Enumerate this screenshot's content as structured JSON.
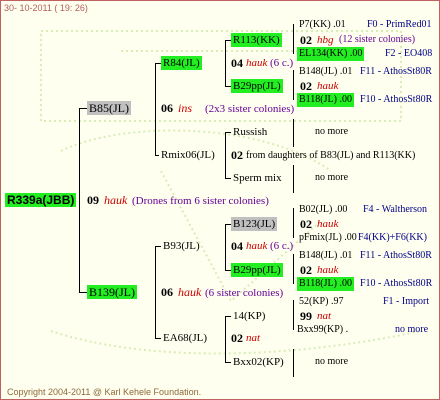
{
  "header": {
    "date": "30- 10-2011 ( 19: 26)"
  },
  "footer": {
    "copyright": "Copyright 2004-2011 @ Karl Kehele Foundation."
  },
  "root": {
    "id": "R339a(JBB)",
    "gen": "09",
    "breeder": "hauk",
    "note": "(Drones from 6 sister colonies)"
  },
  "upper": {
    "id": "B85(JL)",
    "gen": "06",
    "breeder": "ins",
    "note": "(2x3 sister colonies)",
    "a": {
      "id": "R84(JL)",
      "gen": "04",
      "breeder": "hauk",
      "note": "(6 c.)"
    },
    "a1": {
      "id": "R113(KK)",
      "gen": "02",
      "breeder": "hbg",
      "note": "(12 sister colonies)"
    },
    "a2": {
      "id": "B29pp(JL)",
      "gen": "02",
      "breeder": "hauk"
    },
    "b": {
      "id": "Rmix06(JL)",
      "gen": "02",
      "note": "from daughters of B83(JL) and R113(KK)"
    },
    "b1": {
      "id": "Russish"
    },
    "b2": {
      "id": "Sperm mix"
    }
  },
  "lower": {
    "id": "B139(JL)",
    "gen": "06",
    "breeder": "hauk",
    "note": "(6 sister colonies)",
    "a": {
      "id": "B93(JL)",
      "gen": "04",
      "breeder": "hauk",
      "note": "(6 c.)"
    },
    "a1": {
      "id": "B123(JL)",
      "gen": "02",
      "breeder": "hauk"
    },
    "a2": {
      "id": "B29pp(JL)",
      "gen": "02",
      "breeder": "hauk"
    },
    "b": {
      "id": "EA68(JL)",
      "gen": "02",
      "breeder": "nat"
    },
    "b1": {
      "id": "14(KP)",
      "gen": "99",
      "breeder": "nat"
    },
    "b2": {
      "id": "Bxx02(KP)"
    }
  },
  "right": {
    "r1": {
      "left": "P7(KK) .01",
      "right": "F0 - PrimRed01"
    },
    "r2": {
      "left": "EL134(KK) .00",
      "right": "F2 - EO408"
    },
    "r3": {
      "left": "B148(JL) .01",
      "right": "F11 - AthosSt80R"
    },
    "r4": {
      "left": "B118(JL) .00",
      "right": "F10 - AthosSt80R"
    },
    "r5": {
      "text": "no more"
    },
    "r6": {
      "text": "no more"
    },
    "r7": {
      "left": "B02(JL) .00",
      "right": "F4 - Waltherson"
    },
    "r8": {
      "left": "pFmix(JL) .00",
      "right": "F4(KK)+F6(KK)"
    },
    "r9": {
      "left": "B148(JL) .01",
      "right": "F11 - AthosSt80R"
    },
    "r10": {
      "left": "B118(JL) .00",
      "right": "F10 - AthosSt80R"
    },
    "r11": {
      "left": "52(KP) .97",
      "right": "F1 - Import"
    },
    "r12": {
      "left": "Bxx99(KP) .",
      "right": "no more"
    },
    "r13": {
      "text": "no more"
    }
  },
  "colors": {
    "green": "#22ee22",
    "gray": "#c0c0c0",
    "breeder": "#cc0000",
    "note": "#660099"
  }
}
